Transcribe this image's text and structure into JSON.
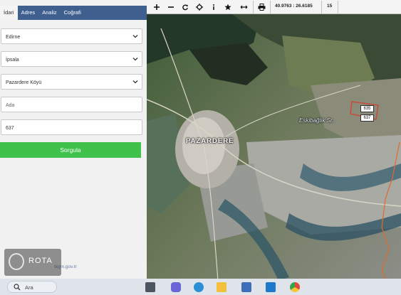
{
  "tabs": [
    {
      "label": "İdari",
      "active": true
    },
    {
      "label": "Adres",
      "active": false
    },
    {
      "label": "Analiz",
      "active": false
    },
    {
      "label": "Coğrafi",
      "active": false
    }
  ],
  "form": {
    "il": "Edirne",
    "ilce": "İpsala",
    "mahalle": "Pazardere Köyü",
    "ada_placeholder": "Ada",
    "parsel_value": "637",
    "submit_label": "Sorgula"
  },
  "footer": {
    "site_link": "tkgm.gov.tr",
    "logo_text": "ROTA"
  },
  "toolbar": {
    "icons": [
      "zoom-in-icon",
      "zoom-out-icon",
      "refresh-icon",
      "locate-icon",
      "info-icon",
      "star-icon",
      "measure-icon",
      "print-icon"
    ],
    "coordinates": "40.9763 : 26.6185",
    "zoom_level": "15"
  },
  "map": {
    "village_label": "PAZARDERE",
    "area_label": "Eskibağlık Sr.",
    "parcels": [
      "635",
      "637"
    ],
    "parcel_highlight_color": "#c84a3a",
    "boundary_color": "#e06a2a"
  },
  "taskbar": {
    "search_label": "Ara",
    "apps": [
      "task-view-icon",
      "chat-icon",
      "edge-icon",
      "file-explorer-icon",
      "store-icon",
      "mail-icon",
      "chrome-icon"
    ]
  }
}
